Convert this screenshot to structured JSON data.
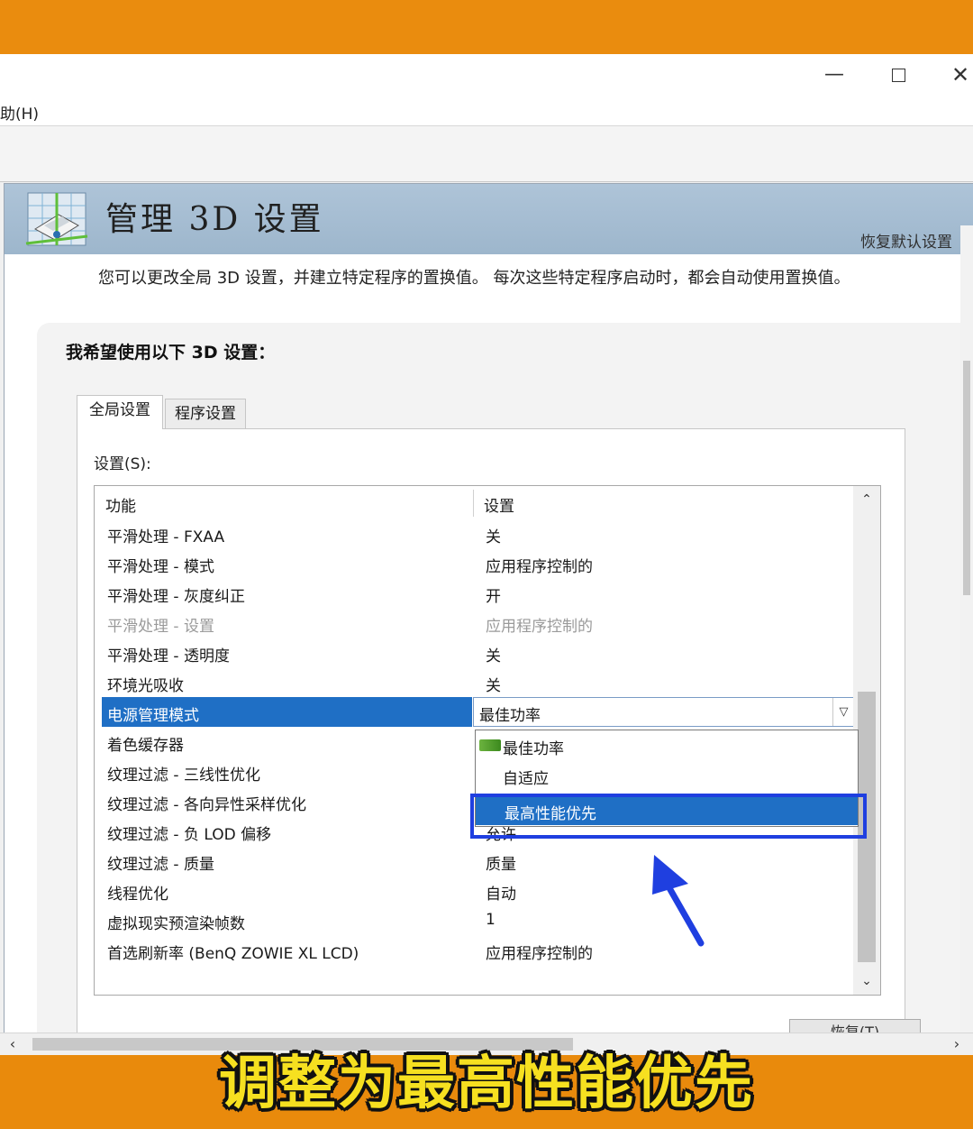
{
  "window": {
    "controls": {
      "minimize": "—",
      "close": "✕"
    },
    "menu": {
      "help": "助(H)"
    }
  },
  "header": {
    "title": "管理 3D 设置",
    "restore_default": "恢复默认设置",
    "description": "您可以更改全局 3D 设置，并建立特定程序的置换值。 每次这些特定程序启动时，都会自动使用置换值。"
  },
  "settings": {
    "section_label": "我希望使用以下 3D 设置：",
    "tabs": [
      {
        "label": "全局设置",
        "active": true
      },
      {
        "label": "程序设置",
        "active": false
      }
    ],
    "caption": "设置(S):",
    "columns": {
      "feature": "功能",
      "setting": "设置"
    },
    "rows": [
      {
        "feature": "平滑处理 - FXAA",
        "value": "关"
      },
      {
        "feature": "平滑处理 - 模式",
        "value": "应用程序控制的"
      },
      {
        "feature": "平滑处理 - 灰度纠正",
        "value": "开"
      },
      {
        "feature": "平滑处理 - 设置",
        "value": "应用程序控制的",
        "disabled": true
      },
      {
        "feature": "平滑处理 - 透明度",
        "value": "关"
      },
      {
        "feature": "环境光吸收",
        "value": "关"
      },
      {
        "feature": "电源管理模式",
        "value": "最佳功率",
        "selected": true
      },
      {
        "feature": "着色缓存器",
        "value": ""
      },
      {
        "feature": "纹理过滤 - 三线性优化",
        "value": ""
      },
      {
        "feature": "纹理过滤 - 各向异性采样优化",
        "value": ""
      },
      {
        "feature": "纹理过滤 - 负 LOD 偏移",
        "value": "允许"
      },
      {
        "feature": "纹理过滤 - 质量",
        "value": "质量"
      },
      {
        "feature": "线程优化",
        "value": "自动"
      },
      {
        "feature": "虚拟现实预渲染帧数",
        "value": "1"
      },
      {
        "feature": "首选刷新率 (BenQ ZOWIE XL LCD)",
        "value": "应用程序控制的"
      }
    ],
    "dropdown_options": [
      {
        "label": "最佳功率",
        "icon": "nvidia-icon"
      },
      {
        "label": "自适应"
      },
      {
        "label": "最高性能优先",
        "highlighted": true
      }
    ],
    "bottom_button": "恢复(T)"
  },
  "overlay_caption": "调整为最高性能优先",
  "colors": {
    "accent_orange": "#ea8c0e",
    "selection_blue": "#1f6fc5",
    "caption_yellow": "#f6e020",
    "annotation_blue": "#1f3fe0"
  }
}
